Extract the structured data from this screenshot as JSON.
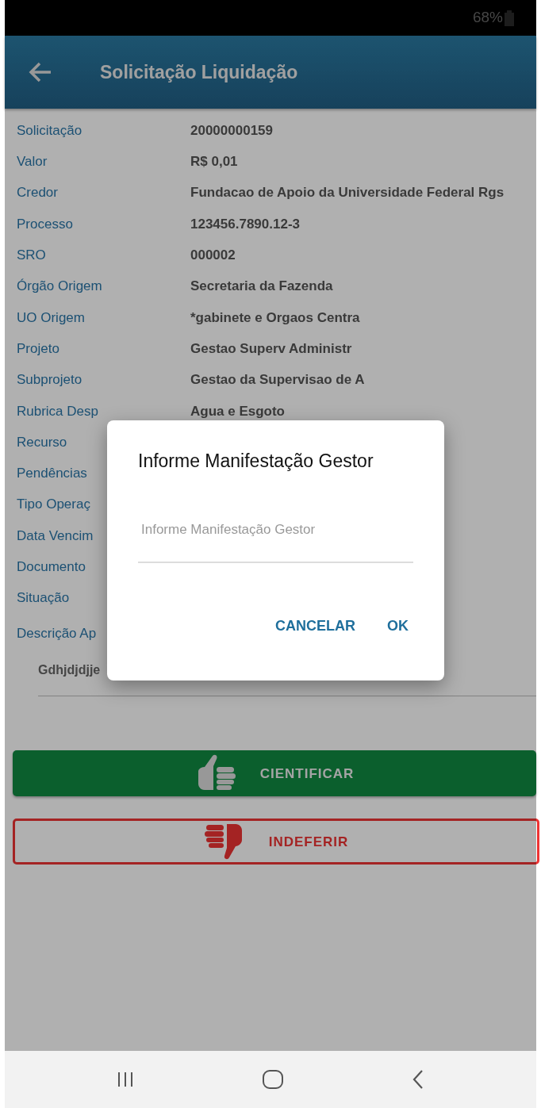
{
  "status_bar": {
    "battery": "68%"
  },
  "header": {
    "title": "Solicitação Liquidação"
  },
  "fields": [
    {
      "label": "Solicitação",
      "value": "20000000159"
    },
    {
      "label": "Valor",
      "value": "R$ 0,01"
    },
    {
      "label": "Credor",
      "value": "Fundacao de Apoio da Universidade Federal Rgs"
    },
    {
      "label": "Processo",
      "value": "123456.7890.12-3"
    },
    {
      "label": "SRO",
      "value": "000002"
    },
    {
      "label": "Órgão Origem",
      "value": "Secretaria da Fazenda"
    },
    {
      "label": "UO Origem",
      "value": "*gabinete e Orgaos Centra"
    },
    {
      "label": "Projeto",
      "value": "Gestao Superv Administr"
    },
    {
      "label": "Subprojeto",
      "value": "Gestao da Supervisao de A"
    },
    {
      "label": "Rubrica Desp",
      "value": "Agua e Esgoto"
    },
    {
      "label": "Recurso"
    },
    {
      "label": "Pendências"
    },
    {
      "label": "Tipo Operaç"
    },
    {
      "label": "Data Vencim"
    },
    {
      "label": "Documento"
    },
    {
      "label": "Situação"
    }
  ],
  "description": {
    "label": "Descrição Ap",
    "value": "Gdhjdjdjje"
  },
  "actions": [
    {
      "kind": "approve",
      "label": "CIENTIFICAR"
    },
    {
      "kind": "reject",
      "label": "INDEFERIR"
    }
  ],
  "dialog": {
    "title": "Informe Manifestação Gestor",
    "placeholder": "Informe Manifestação Gestor",
    "buttons": [
      "CANCELAR",
      "OK"
    ]
  }
}
